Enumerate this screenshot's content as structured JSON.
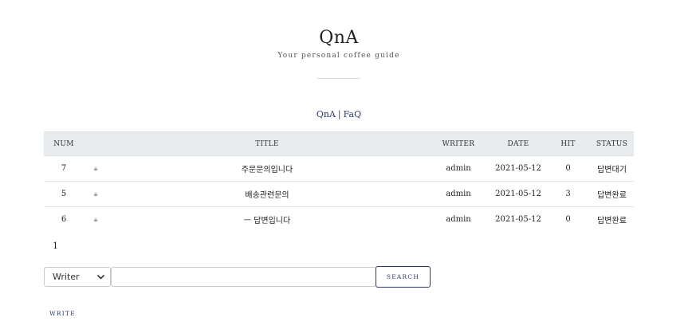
{
  "header": {
    "title": "QnA",
    "subtitle": "Your personal coffee guide"
  },
  "subnav": {
    "items": [
      {
        "label": "QnA"
      },
      {
        "label": "FaQ"
      }
    ],
    "separator": "|"
  },
  "table": {
    "columns": [
      "NUM",
      "TITLE",
      "WRITER",
      "DATE",
      "HIT",
      "STATUS"
    ],
    "rows": [
      {
        "num": "7",
        "locked": true,
        "title": "주문문의입니다",
        "writer": "admin",
        "date": "2021-05-12",
        "hit": "0",
        "status": "답변대기"
      },
      {
        "num": "5",
        "locked": true,
        "title": "배송관련문의",
        "writer": "admin",
        "date": "2021-05-12",
        "hit": "3",
        "status": "답변완료"
      },
      {
        "num": "6",
        "locked": true,
        "title": "ㅡ 답변입니다",
        "writer": "admin",
        "date": "2021-05-12",
        "hit": "0",
        "status": "답변완료"
      }
    ],
    "lock_icon": "lock-icon"
  },
  "pagination": {
    "current": "1"
  },
  "search": {
    "field_selected": "Writer",
    "input_value": "",
    "button_label": "SEARCH"
  },
  "write": {
    "label": "WRITE"
  },
  "colors": {
    "accent": "#2d3a66",
    "header_bg": "#e9ecef"
  }
}
